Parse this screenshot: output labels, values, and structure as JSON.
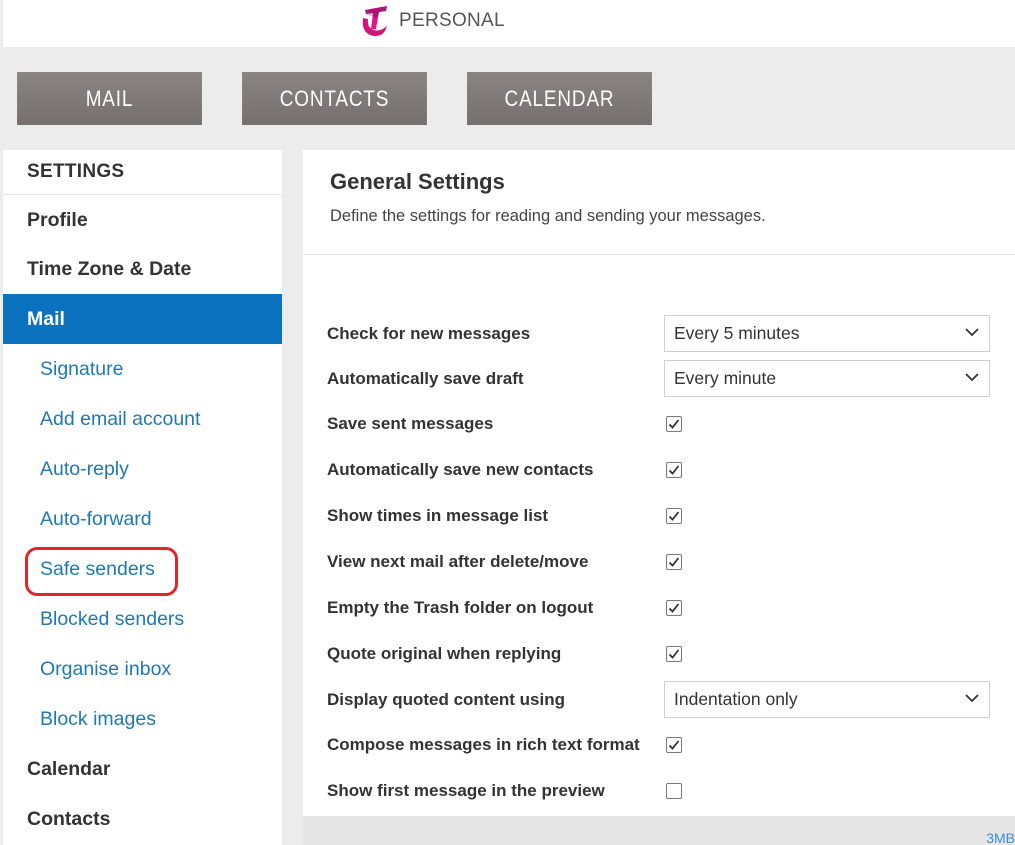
{
  "header": {
    "brand_text": "PERSONAL",
    "logo_icon": "telstra-t-logo",
    "logo_color": "#d0157d"
  },
  "nav": {
    "tabs": [
      {
        "label": "MAIL"
      },
      {
        "label": "CONTACTS"
      },
      {
        "label": "CALENDAR"
      }
    ]
  },
  "sidebar": {
    "heading": "SETTINGS",
    "items": [
      {
        "label": "Profile"
      },
      {
        "label": "Time Zone & Date"
      },
      {
        "label": "Mail",
        "active": true
      },
      {
        "label": "Signature"
      },
      {
        "label": "Add email account"
      },
      {
        "label": "Auto-reply"
      },
      {
        "label": "Auto-forward"
      },
      {
        "label": "Safe senders",
        "highlighted": true
      },
      {
        "label": "Blocked senders"
      },
      {
        "label": "Organise inbox"
      },
      {
        "label": "Block images"
      },
      {
        "label": "Calendar"
      },
      {
        "label": "Contacts"
      }
    ]
  },
  "main": {
    "title": "General Settings",
    "description": "Define the settings for reading and sending your messages.",
    "settings": [
      {
        "label": "Check for new messages",
        "type": "select",
        "value": "Every 5 minutes"
      },
      {
        "label": "Automatically save draft",
        "type": "select",
        "value": "Every minute"
      },
      {
        "label": "Save sent messages",
        "type": "checkbox",
        "checked": true
      },
      {
        "label": "Automatically save new contacts",
        "type": "checkbox",
        "checked": true
      },
      {
        "label": "Show times in message list",
        "type": "checkbox",
        "checked": true
      },
      {
        "label": "View next mail after delete/move",
        "type": "checkbox",
        "checked": true
      },
      {
        "label": "Empty the Trash folder on logout",
        "type": "checkbox",
        "checked": true
      },
      {
        "label": "Quote original when replying",
        "type": "checkbox",
        "checked": true
      },
      {
        "label": "Display quoted content using",
        "type": "select",
        "value": "Indentation only"
      },
      {
        "label": "Compose messages in rich text format",
        "type": "checkbox",
        "checked": true
      },
      {
        "label": "Show first message in the preview",
        "type": "checkbox",
        "checked": false
      }
    ]
  },
  "footer": {
    "storage_text": "3MB"
  },
  "colors": {
    "active_item": "#0b72c0",
    "link": "#1f78b4",
    "highlight_ring": "#e0262b",
    "nav_tab": "#7f7977"
  }
}
